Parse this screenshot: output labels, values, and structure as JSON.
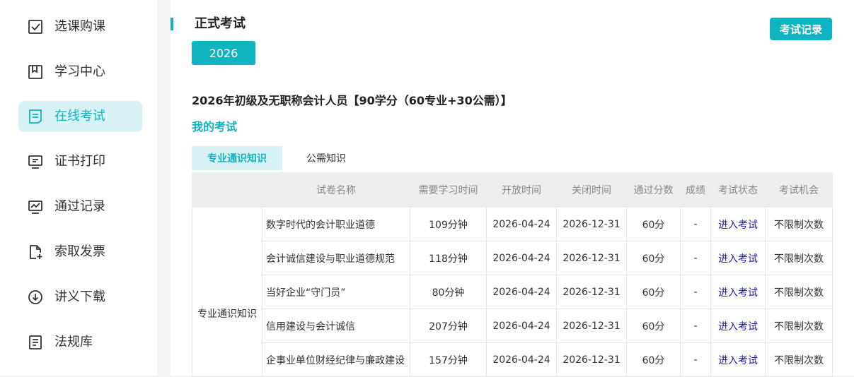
{
  "sidebar": {
    "items": [
      {
        "label": "选课购课",
        "icon": "checkbox-icon",
        "active": false
      },
      {
        "label": "学习中心",
        "icon": "bookmark-icon",
        "active": false
      },
      {
        "label": "在线考试",
        "icon": "exam-icon",
        "active": true
      },
      {
        "label": "证书打印",
        "icon": "certificate-monitor-icon",
        "active": false
      },
      {
        "label": "通过记录",
        "icon": "chart-monitor-icon",
        "active": false
      },
      {
        "label": "索取发票",
        "icon": "add-document-icon",
        "active": false
      },
      {
        "label": "讲义下载",
        "icon": "download-icon",
        "active": false
      },
      {
        "label": "法规库",
        "icon": "document-list-icon",
        "active": false
      }
    ]
  },
  "header": {
    "title": "正式考试",
    "record_button": "考试记录",
    "year": "2026"
  },
  "course_title": "2026年初级及无职称会计人员【90学分（60专业+30公需）】",
  "my_exam_label": "我的考试",
  "tabs": [
    {
      "label": "专业通识知识",
      "active": true
    },
    {
      "label": "公需知识",
      "active": false
    }
  ],
  "table": {
    "headers": [
      "试卷名称",
      "需要学习时间",
      "开放时间",
      "关闭时间",
      "通过分数",
      "成绩",
      "考试状态",
      "考试机会"
    ],
    "category": "专业通识知识",
    "rows": [
      {
        "name": "数字时代的会计职业道德",
        "study_time": "109分钟",
        "open": "2026-04-24",
        "close": "2026-12-31",
        "pass_score": "60分",
        "score": "-",
        "status": "进入考试",
        "chances": "不限制次数"
      },
      {
        "name": "会计诚信建设与职业道德规范",
        "study_time": "118分钟",
        "open": "2026-04-24",
        "close": "2026-12-31",
        "pass_score": "60分",
        "score": "-",
        "status": "进入考试",
        "chances": "不限制次数"
      },
      {
        "name": "当好企业“守门员”",
        "study_time": "80分钟",
        "open": "2026-04-24",
        "close": "2026-12-31",
        "pass_score": "60分",
        "score": "-",
        "status": "进入考试",
        "chances": "不限制次数"
      },
      {
        "name": "信用建设与会计诚信",
        "study_time": "207分钟",
        "open": "2026-04-24",
        "close": "2026-12-31",
        "pass_score": "60分",
        "score": "-",
        "status": "进入考试",
        "chances": "不限制次数"
      },
      {
        "name": "企事业单位财经纪律与廉政建设",
        "study_time": "157分钟",
        "open": "2026-04-24",
        "close": "2026-12-31",
        "pass_score": "60分",
        "score": "-",
        "status": "进入考试",
        "chances": "不限制次数"
      }
    ]
  },
  "colors": {
    "accent": "#0fb4c0",
    "accent_light": "#d9f2f5",
    "link": "#1a1aa6"
  }
}
